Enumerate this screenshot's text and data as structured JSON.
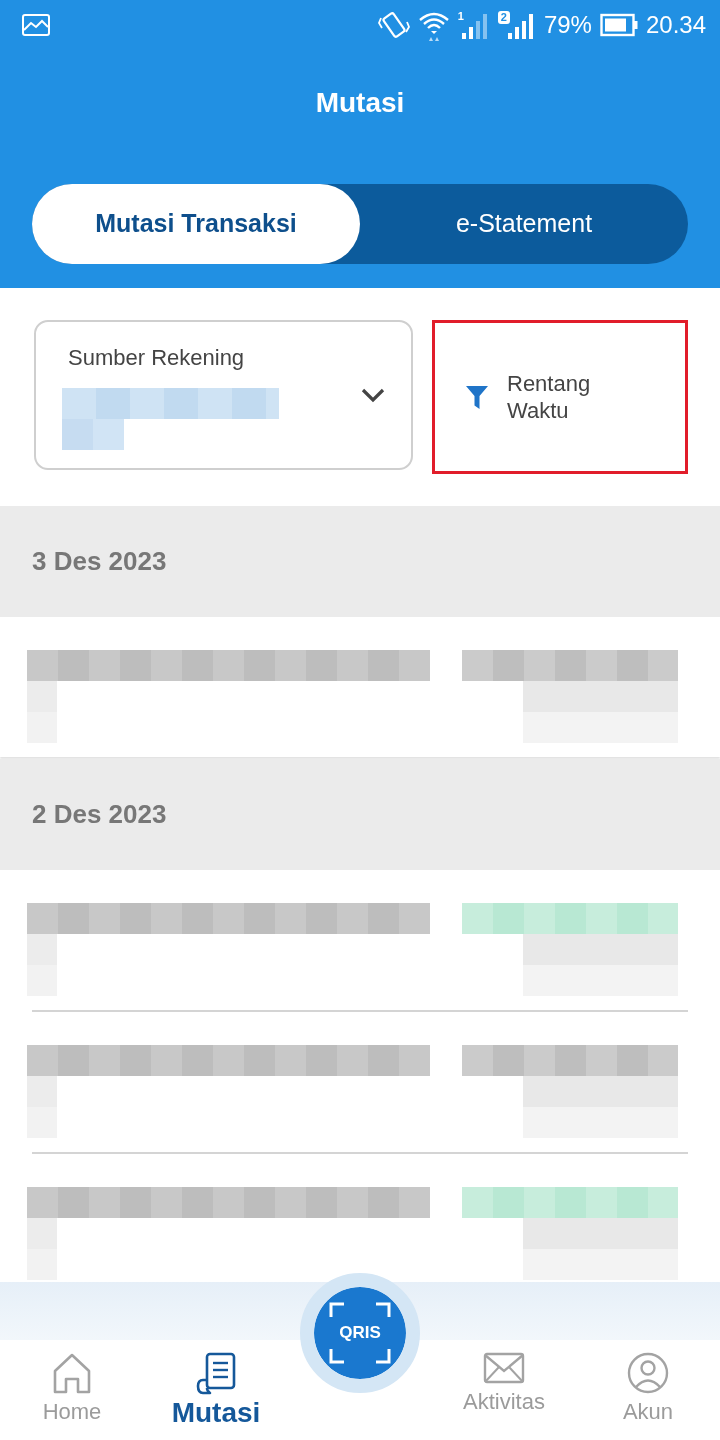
{
  "status_bar": {
    "signals": [
      {
        "label": "1",
        "active": false
      },
      {
        "label": "2",
        "active": true
      }
    ],
    "battery": "79%",
    "time": "20.34"
  },
  "header": {
    "title": "Mutasi"
  },
  "tabs": [
    {
      "label": "Mutasi Transaksi",
      "selected": true
    },
    {
      "label": "e-Statement",
      "selected": false
    }
  ],
  "filters": {
    "account": {
      "label": "Sumber Rekening"
    },
    "date_range": {
      "label": "Rentang Waktu",
      "highlighted": true
    }
  },
  "groups": [
    {
      "date": "3 Des 2023",
      "transactions": [
        {
          "kind": "debit"
        }
      ]
    },
    {
      "date": "2 Des 2023",
      "transactions": [
        {
          "kind": "credit"
        },
        {
          "kind": "debit"
        },
        {
          "kind": "credit"
        }
      ]
    }
  ],
  "scan_button": {
    "label": "QRIS"
  },
  "nav_items": [
    {
      "kind": "home",
      "label": "Home",
      "selected": false
    },
    {
      "kind": "mutations",
      "label": "Mutasi",
      "selected": true
    },
    {
      "kind": "messages",
      "label": "Aktivitas",
      "selected": false
    },
    {
      "kind": "account",
      "label": "Akun",
      "selected": false
    }
  ]
}
